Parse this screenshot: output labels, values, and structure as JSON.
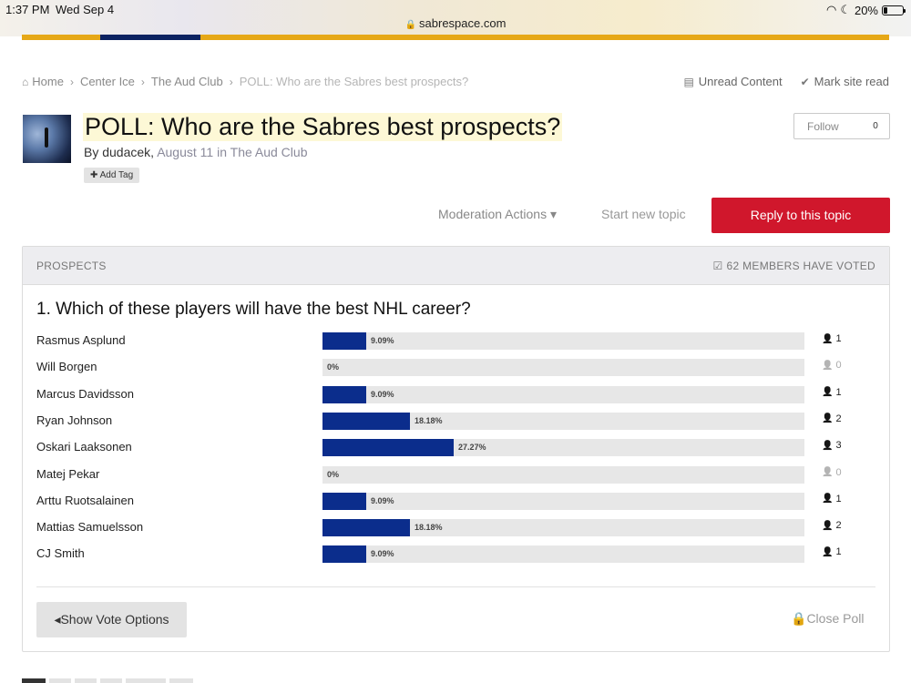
{
  "status": {
    "time": "1:37 PM",
    "date": "Wed Sep 4",
    "battery": "20%",
    "url": "sabrespace.com"
  },
  "breadcrumb": {
    "items": [
      "Home",
      "Center Ice",
      "The Aud Club"
    ],
    "current": "POLL: Who are the Sabres best prospects?"
  },
  "top_actions": {
    "unread": "Unread Content",
    "mark_read": "Mark site read"
  },
  "topic": {
    "title": "POLL: Who are the Sabres best prospects?",
    "by_prefix": "By ",
    "author": "dudacek",
    "date": "August 11",
    "in_text": " in ",
    "forum": "The Aud Club",
    "add_tag": "Add Tag",
    "follow_label": "Follow",
    "follow_count": "0"
  },
  "actions": {
    "moderation": "Moderation Actions",
    "start_new": "Start new topic",
    "reply": "Reply to this topic"
  },
  "poll": {
    "header": "PROSPECTS",
    "voted": "62 MEMBERS HAVE VOTED",
    "question": "1. Which of these players will have the best NHL career?",
    "rows": [
      {
        "name": "Rasmus Asplund",
        "pct": "9.09%",
        "fraction": 0.0909,
        "votes": "1"
      },
      {
        "name": "Will Borgen",
        "pct": "0%",
        "fraction": 0,
        "votes": "0"
      },
      {
        "name": "Marcus Davidsson",
        "pct": "9.09%",
        "fraction": 0.0909,
        "votes": "1"
      },
      {
        "name": "Ryan Johnson",
        "pct": "18.18%",
        "fraction": 0.1818,
        "votes": "2"
      },
      {
        "name": "Oskari Laaksonen",
        "pct": "27.27%",
        "fraction": 0.2727,
        "votes": "3"
      },
      {
        "name": "Matej Pekar",
        "pct": "0%",
        "fraction": 0,
        "votes": "0"
      },
      {
        "name": "Arttu Ruotsalainen",
        "pct": "9.09%",
        "fraction": 0.0909,
        "votes": "1"
      },
      {
        "name": "Mattias Samuelsson",
        "pct": "18.18%",
        "fraction": 0.1818,
        "votes": "2"
      },
      {
        "name": "CJ Smith",
        "pct": "9.09%",
        "fraction": 0.0909,
        "votes": "1"
      }
    ],
    "show_vote_options": "Show Vote Options",
    "close_poll": "Close Poll"
  },
  "colors": {
    "brand_gold": "#e6a817",
    "brand_navy": "#0b2261",
    "bar_fill": "#0b2d8c",
    "reply_red": "#d0172c"
  }
}
